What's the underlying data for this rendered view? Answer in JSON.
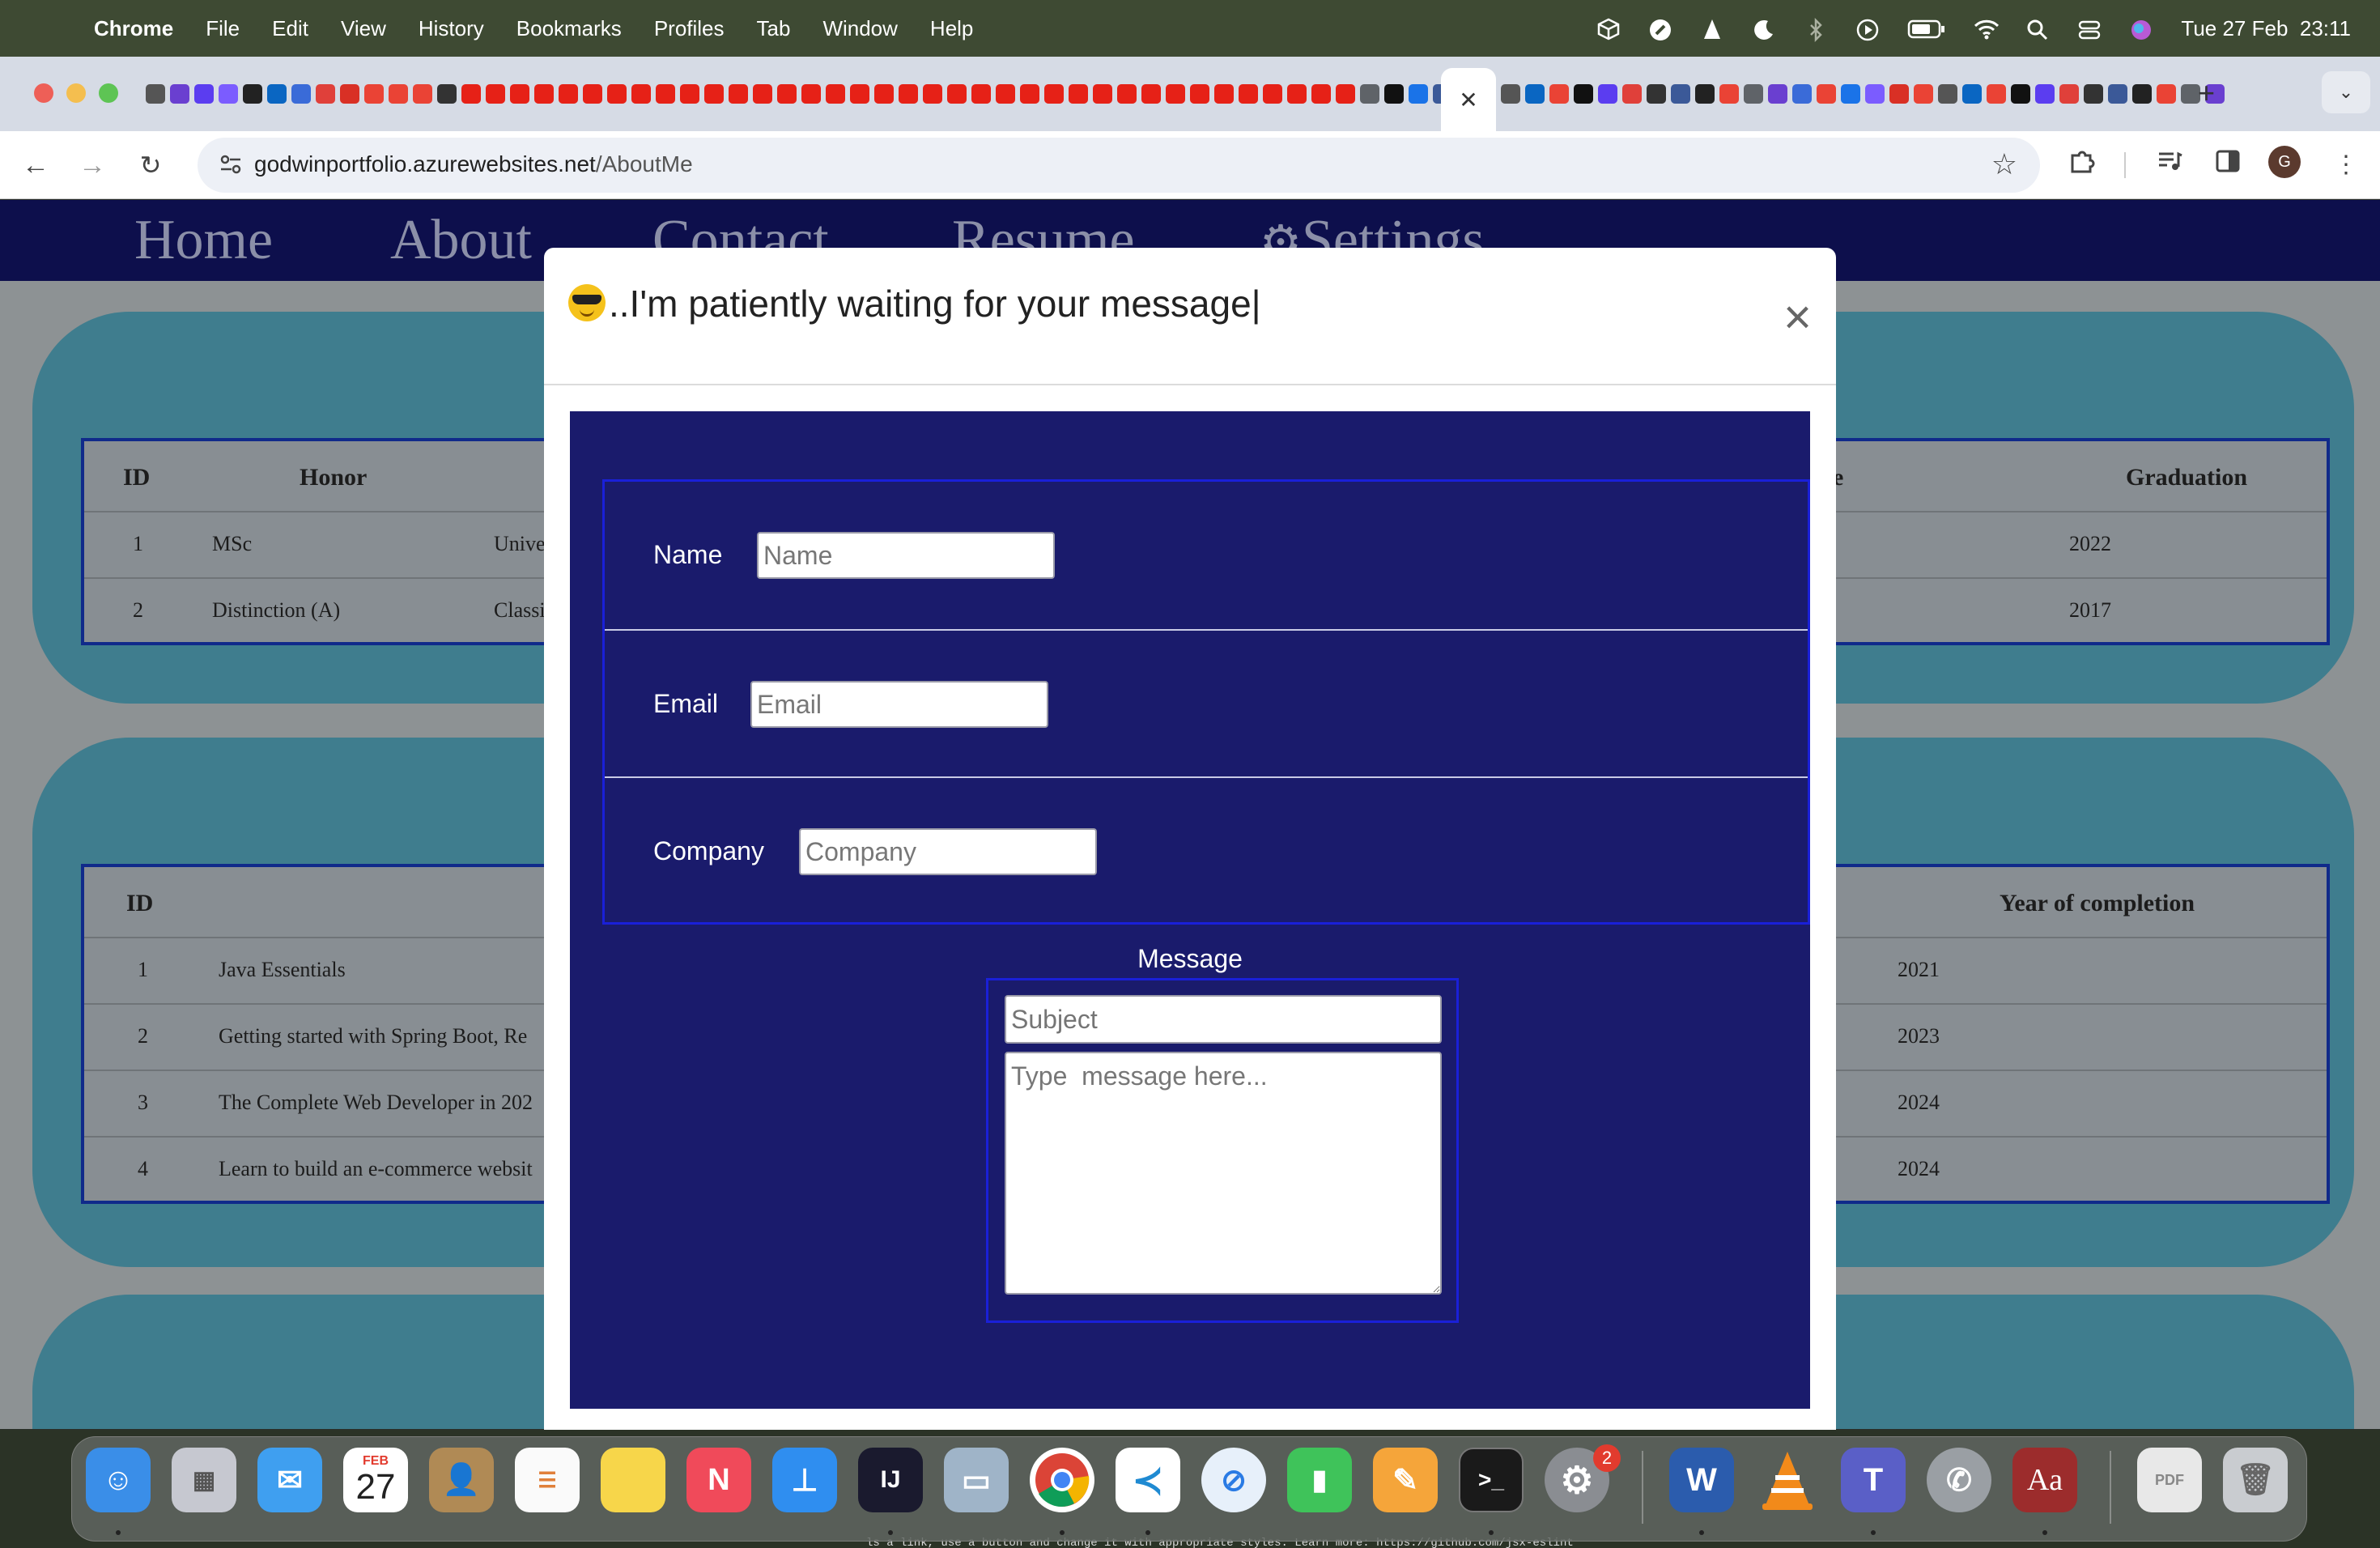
{
  "menubar": {
    "app": "Chrome",
    "items": [
      "File",
      "Edit",
      "View",
      "History",
      "Bookmarks",
      "Profiles",
      "Tab",
      "Window",
      "Help"
    ],
    "datetime": "Tue 27 Feb  23:11"
  },
  "browser": {
    "url_host": "godwinportfolio.azurewebsites.net",
    "url_path": "/AboutMe",
    "profile_initial": "G"
  },
  "site_nav": {
    "links": [
      "Home",
      "About",
      "Contact",
      "Resume",
      "Settings"
    ]
  },
  "honors_table": {
    "headers": [
      "ID",
      "Honor",
      "Graduation"
    ],
    "partial_header": "e",
    "rows": [
      {
        "id": "1",
        "honor": "MSc",
        "institution": "Unive",
        "graduation": "2022"
      },
      {
        "id": "2",
        "honor": "Distinction (A)",
        "institution": "Classi",
        "graduation": "2017"
      }
    ]
  },
  "courses_table": {
    "headers": [
      "ID",
      "Year of completion"
    ],
    "rows": [
      {
        "id": "1",
        "course": "Java Essentials",
        "year": "2021"
      },
      {
        "id": "2",
        "course": "Getting started with Spring Boot, Re",
        "year": "2023"
      },
      {
        "id": "3",
        "course": "The Complete Web Developer in 202",
        "year": "2024"
      },
      {
        "id": "4",
        "course": "Learn to build an e-commerce websit",
        "year": "2024"
      }
    ]
  },
  "modal": {
    "title": "..I'm patiently waiting for your message|",
    "close": "×",
    "fields": [
      {
        "label": "Name",
        "placeholder": "Name"
      },
      {
        "label": "Email",
        "placeholder": "Email"
      },
      {
        "label": "Company",
        "placeholder": "Company"
      }
    ],
    "message_label": "Message",
    "subject_placeholder": "Subject",
    "message_placeholder": "Type  message here..."
  },
  "dock": {
    "calendar_month": "FEB",
    "calendar_day": "27",
    "settings_badge": "2"
  },
  "terminal_fragment": "ls a link, use a button and change it with appropriate styles. Learn more: https://github.com/jsx-eslint"
}
